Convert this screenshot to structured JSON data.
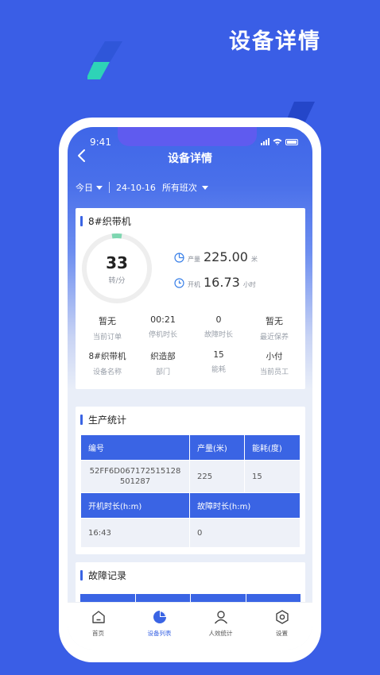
{
  "promo": {
    "title": "设备详情"
  },
  "status_bar": {
    "time": "9:41"
  },
  "nav": {
    "title": "设备详情"
  },
  "filters": {
    "period": "今日",
    "date": "24-10-16",
    "shift": "所有班次"
  },
  "device_card": {
    "name": "8#织带机",
    "speed": {
      "value": "33",
      "unit": "转/分"
    },
    "output": {
      "label": "产量",
      "value": "225.00",
      "unit": "米"
    },
    "run_time": {
      "label": "开机",
      "value": "16.73",
      "unit": "小时"
    },
    "stats": [
      {
        "value": "暂无",
        "label": "当前订单"
      },
      {
        "value": "00:21",
        "label": "停机时长"
      },
      {
        "value": "0",
        "label": "故障时长"
      },
      {
        "value": "暂无",
        "label": "最近保养"
      },
      {
        "value": "8#织带机",
        "label": "设备名称"
      },
      {
        "value": "织造部",
        "label": "部门"
      },
      {
        "value": "15",
        "label": "能耗"
      },
      {
        "value": "小付",
        "label": "当前员工"
      }
    ]
  },
  "production": {
    "title": "生产统计",
    "headers1": [
      "编号",
      "产量(米)",
      "能耗(度)"
    ],
    "row1": {
      "id_line1": "52FF6D067172515128",
      "id_line2": "501287",
      "output": "225",
      "energy": "15"
    },
    "headers2": [
      "开机时长(h:m)",
      "故障时长(h:m)"
    ],
    "row2": [
      "16:43",
      "0"
    ]
  },
  "fault": {
    "title": "故障记录"
  },
  "tabbar": [
    {
      "label": "首页",
      "icon": "home-icon"
    },
    {
      "label": "设备列表",
      "icon": "pie-chart-icon",
      "active": true
    },
    {
      "label": "人效统计",
      "icon": "user-icon"
    },
    {
      "label": "设置",
      "icon": "settings-icon"
    }
  ],
  "colors": {
    "brand": "#3a64e4",
    "background": "#3a5ee6",
    "accent": "#2ed3b7"
  }
}
